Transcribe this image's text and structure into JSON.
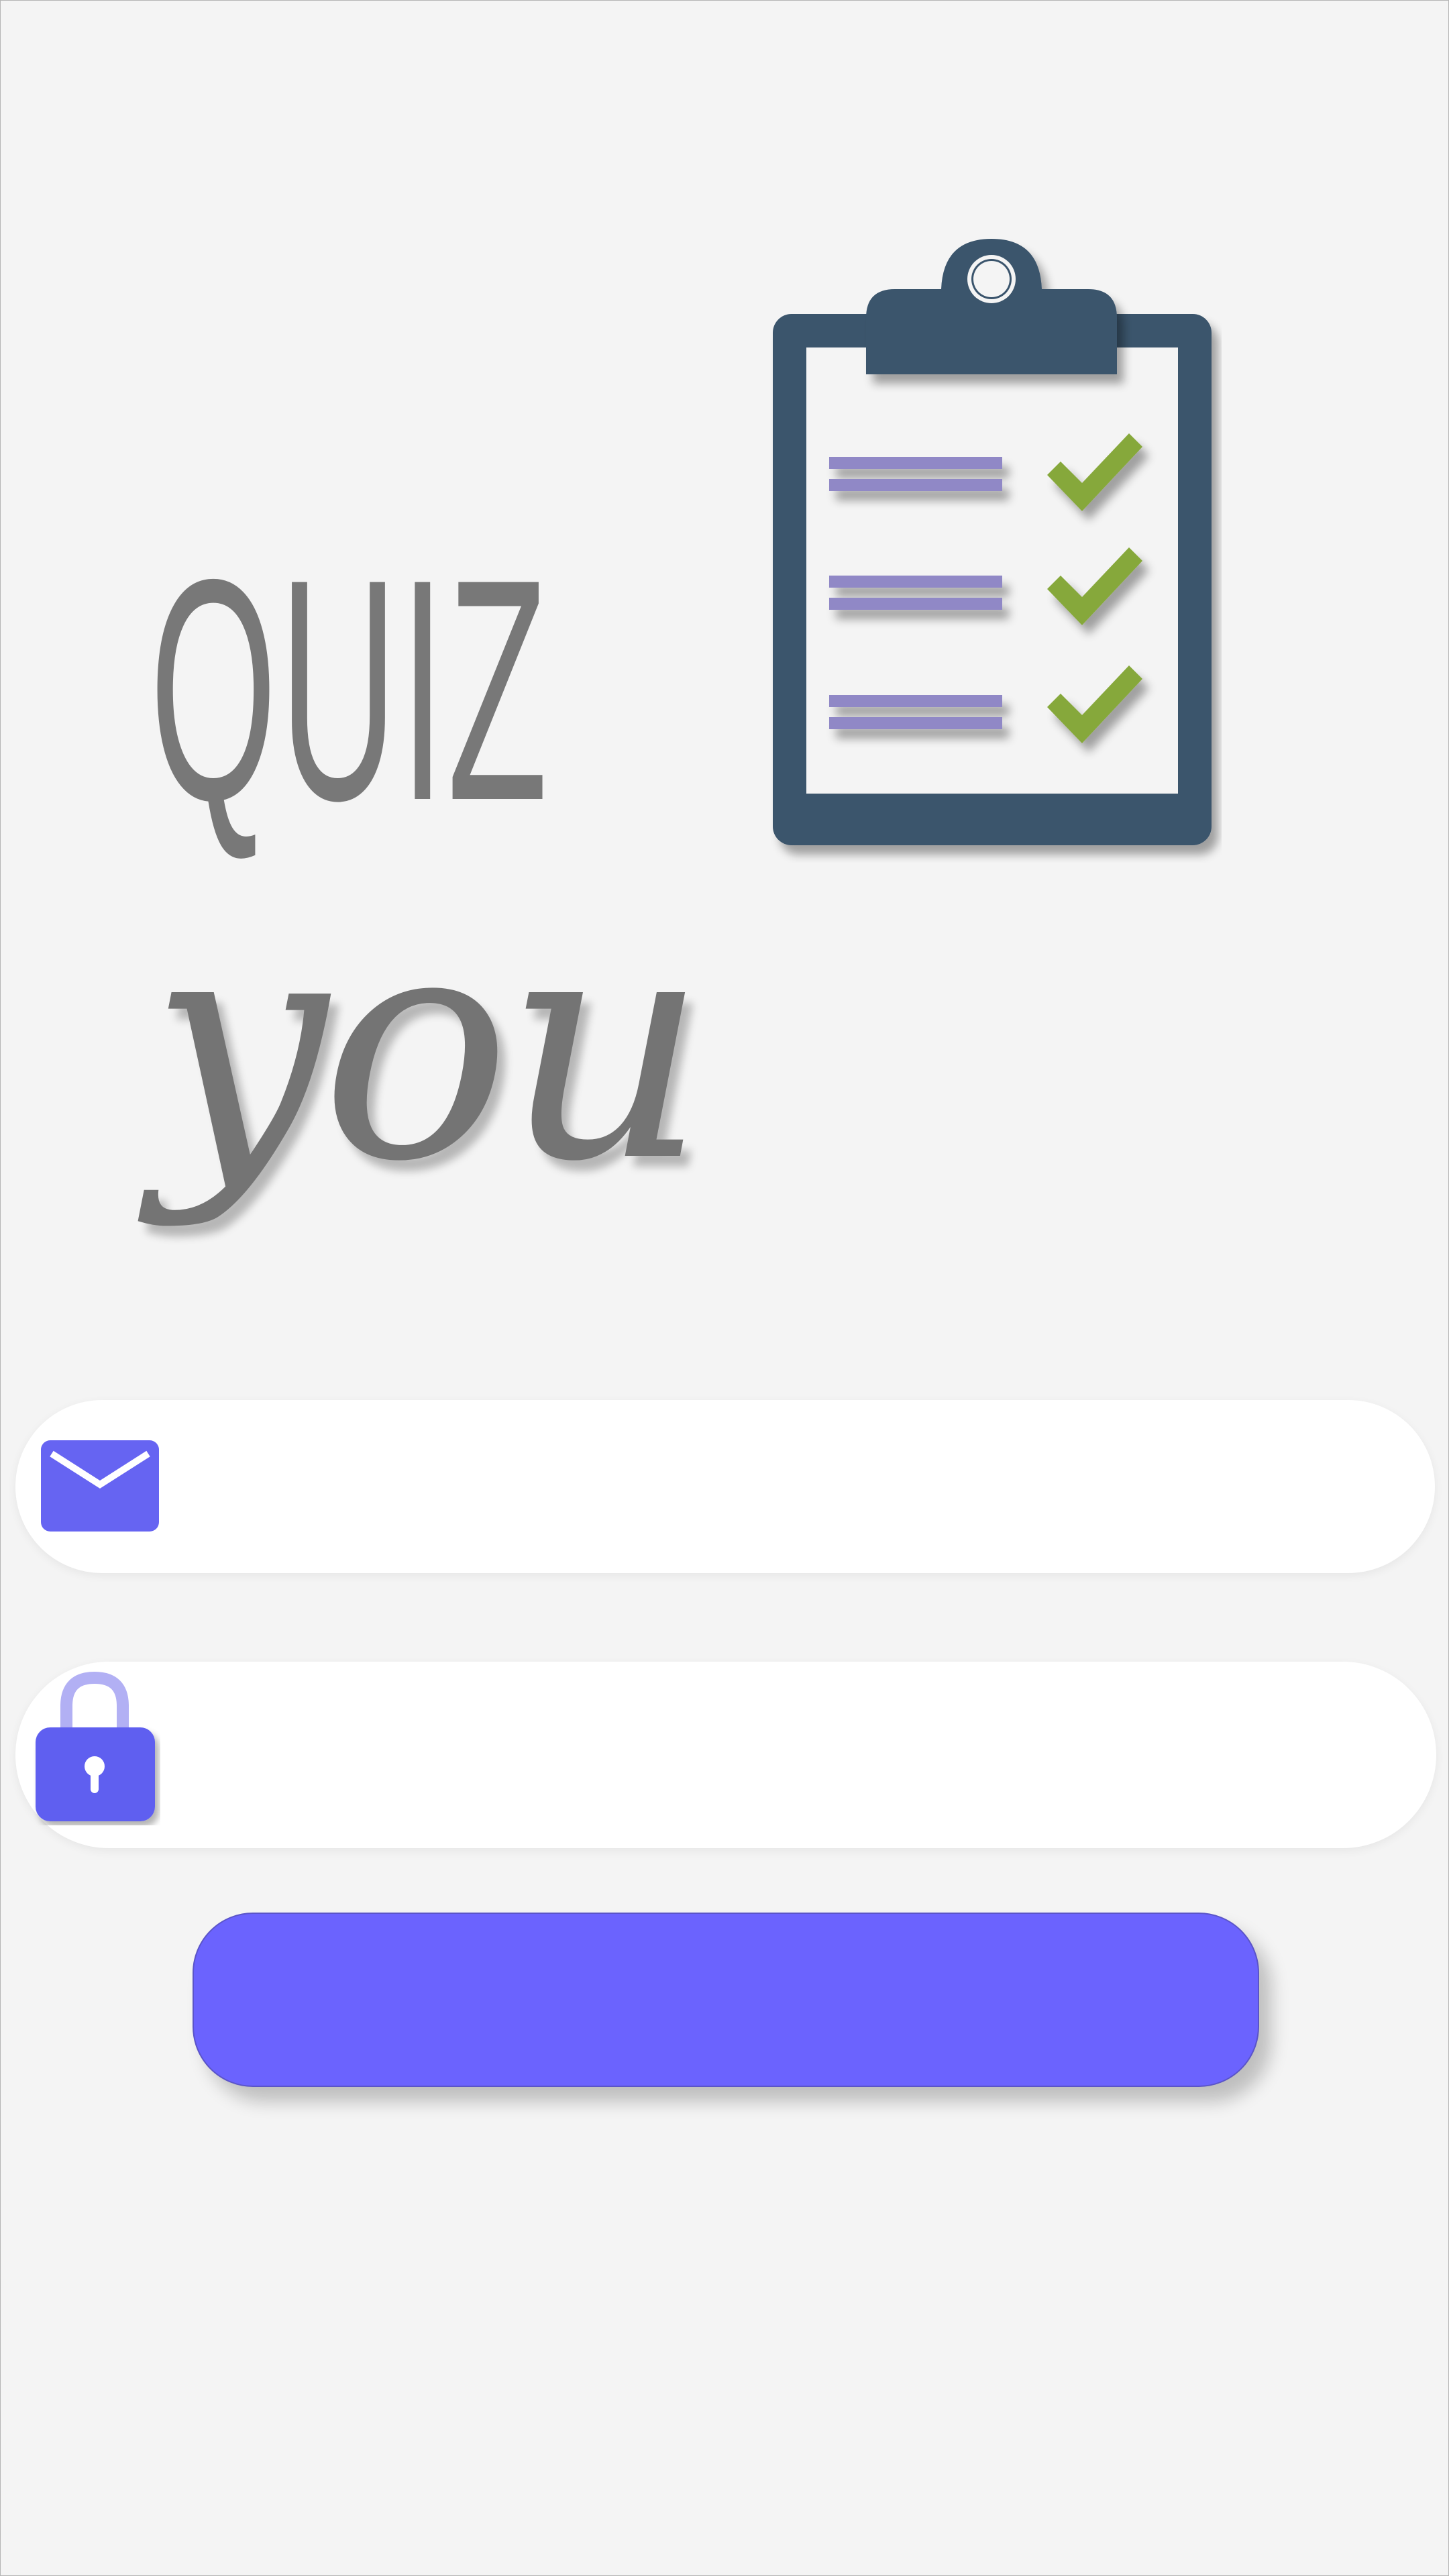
{
  "branding": {
    "title_word_1": "QUIZ",
    "title_word_2": "you"
  },
  "login_form": {
    "email_input": {
      "value": "",
      "placeholder": ""
    },
    "password_input": {
      "value": "",
      "placeholder": ""
    },
    "submit_label": ""
  },
  "icons": {
    "logo": "clipboard-checklist-icon",
    "email": "envelope-icon",
    "password": "padlock-icon"
  },
  "colors": {
    "background": "#f4f4f4",
    "accent": "#6b63fe",
    "title_text": "#787878",
    "clipboard": "#3a546c",
    "checkmark": "#86a83a",
    "list_line": "#9088c6",
    "field_background": "#ffffff"
  }
}
